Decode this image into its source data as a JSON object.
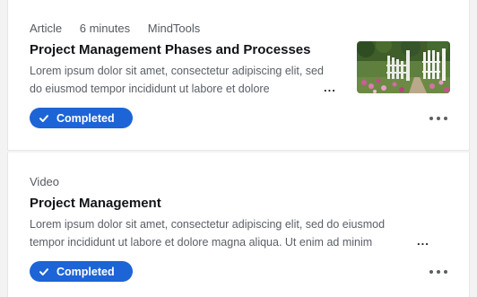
{
  "items": [
    {
      "type": "Article",
      "duration": "6 minutes",
      "source": "MindTools",
      "title": "Project Management Phases and Processes",
      "description": "Lorem ipsum dolor sit amet, consectetur adipiscing elit, sed do eiusmod tempor incididunt ut labore et dolore",
      "truncation": "...",
      "status": "Completed",
      "thumbnail_icon": "garden-gate-image",
      "more_icon": "more-horizontal-icon"
    },
    {
      "type": "Video",
      "title": "Project Management",
      "description": "Lorem ipsum dolor sit amet, consectetur adipiscing elit, sed do eiusmod tempor incididunt ut labore et dolore magna aliqua. Ut enim ad minim",
      "truncation": "...",
      "status": "Completed",
      "more_icon": "more-horizontal-icon"
    }
  ],
  "colors": {
    "badge": "#1d64d6",
    "title": "#111418",
    "meta": "#555a60"
  }
}
